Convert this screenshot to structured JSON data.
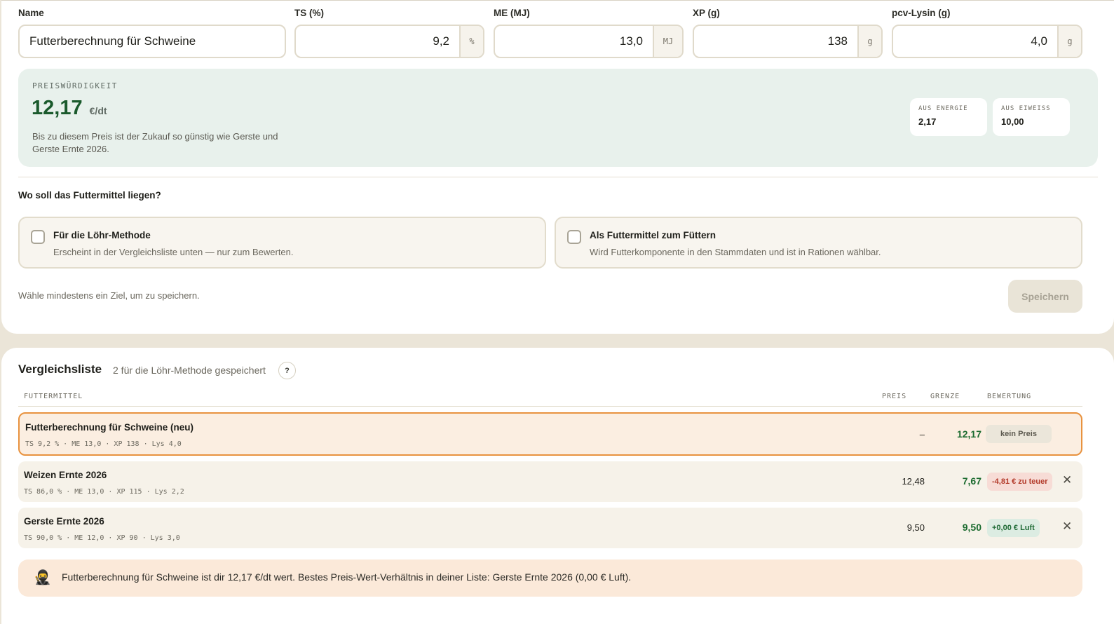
{
  "fields": {
    "name": {
      "label": "Name",
      "value": "Futterberechnung für Schweine"
    },
    "ts": {
      "label": "TS (%)",
      "value": "9,2",
      "unit": "%"
    },
    "me": {
      "label": "ME (MJ)",
      "value": "13,0",
      "unit": "MJ"
    },
    "xp": {
      "label": "XP (g)",
      "value": "138",
      "unit": "g"
    },
    "lys": {
      "label": "pcv-Lysin (g)",
      "value": "4,0",
      "unit": "g"
    }
  },
  "price": {
    "label": "PREISWÜRDIGKEIT",
    "value": "12,17",
    "unit": "€/dt",
    "description": "Bis zu diesem Preis ist der Zukauf so günstig wie Gerste und Gerste Ernte 2026.",
    "chips": [
      {
        "label": "AUS ENERGIE",
        "value": "2,17"
      },
      {
        "label": "AUS EIWEISS",
        "value": "10,00"
      }
    ]
  },
  "target": {
    "question": "Wo soll das Futtermittel liegen?",
    "options": [
      {
        "title": "Für die Löhr-Methode",
        "desc": "Erscheint in der Vergleichsliste unten — nur zum Bewerten."
      },
      {
        "title": "Als Futtermittel zum Füttern",
        "desc": "Wird Futterkomponente in den Stammdaten und ist in Rationen wählbar."
      }
    ],
    "hint": "Wähle mindestens ein Ziel, um zu speichern.",
    "save_label": "Speichern"
  },
  "list": {
    "title": "Vergleichsliste",
    "subtitle": "2 für die Löhr-Methode gespeichert",
    "help": "?",
    "headers": {
      "feed": "FUTTERMITTEL",
      "price": "PREIS",
      "limit": "GRENZE",
      "rating": "BEWERTUNG"
    },
    "rows": [
      {
        "name": "Futterberechnung für Schweine (neu)",
        "meta": "TS 9,2 % · ME 13,0 · XP 138 · Lys 4,0",
        "price": "–",
        "limit": "12,17",
        "rating": "kein Preis"
      },
      {
        "name": "Weizen Ernte 2026",
        "meta": "TS 86,0 % · ME 13,0 · XP 115 · Lys 2,2",
        "price": "12,48",
        "limit": "7,67",
        "rating": "-4,81 € zu teuer"
      },
      {
        "name": "Gerste Ernte 2026",
        "meta": "TS 90,0 % · ME 12,0 · XP 90 · Lys 3,0",
        "price": "9,50",
        "limit": "9,50",
        "rating": "+0,00 € Luft"
      }
    ]
  },
  "banner": {
    "icon": "ninja-icon",
    "text": "Futterberechnung für Schweine ist dir 12,17 €/dt wert. Bestes Preis-Wert-Verhältnis in deiner Liste: Gerste Ernte 2026 (0,00 € Luft)."
  },
  "colors": {
    "accent_green": "#1a6a2e",
    "highlight_orange": "#e8923e",
    "price_box": "#e8f1ec"
  }
}
